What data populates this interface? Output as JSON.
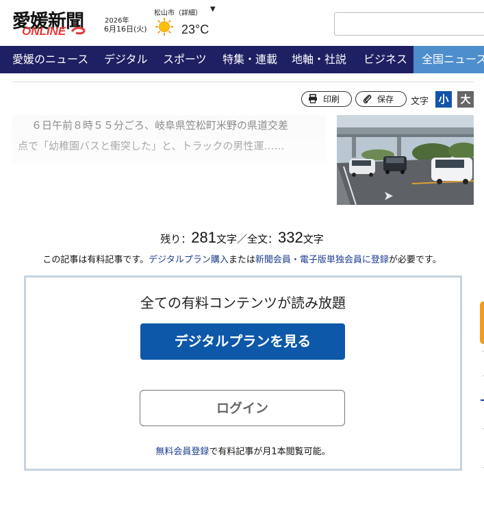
{
  "header": {
    "logo_title": "愛媛新聞",
    "logo_sub": "ONLINE",
    "date_year": "2026年",
    "date_day": "6月16日(火)",
    "city": "松山市（詳細）",
    "city_caret": "▼",
    "weather_icon": "sun-icon",
    "temperature": "23°C"
  },
  "nav": {
    "items": [
      {
        "label": "愛媛のニュース"
      },
      {
        "label": "デジタル"
      },
      {
        "label": "スポーツ"
      },
      {
        "label": "特集・連載"
      },
      {
        "label": "地軸・社説"
      },
      {
        "label": "ビジネス"
      },
      {
        "label": "全国ニュース"
      }
    ]
  },
  "toolbar": {
    "print_label": "印刷",
    "save_label": "保存",
    "text_size_label": "文字",
    "size_small": "小",
    "size_large": "大",
    "active_color": "#1155aa",
    "inactive_color": "#666666"
  },
  "article": {
    "lead_line1": "６日午前８時５５分ごろ、岐阜県笠松町米野の県道交差",
    "lead_line2": "点で「幼稚園バスと衝突した」と、トラックの男性運……"
  },
  "paywall": {
    "remain_prefix": "残り：",
    "remain_count": "281",
    "remain_mid": "文字／全文：",
    "total_count": "332",
    "remain_suffix": "文字",
    "notice_1": "この記事は有料記事です。",
    "notice_link1": "デジタルプラン購入",
    "notice_2": "または",
    "notice_link2": "新聞会員・電子版単独会員に登録",
    "notice_3": "が必要です。",
    "box_title": "全ての有料コンテンツが読み放題",
    "plan_button": "デジタルプランを見る",
    "login_button": "ログイン",
    "free_link": "無料会員登録",
    "free_text": "で有料記事が月1本閲覧可能。"
  }
}
